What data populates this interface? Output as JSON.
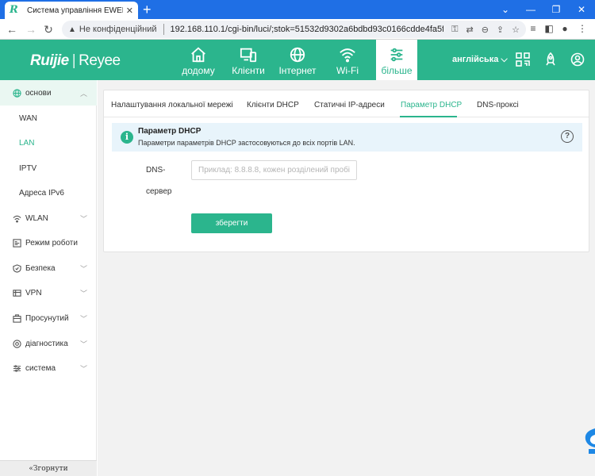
{
  "browser": {
    "tab_title": "Система управління EWEB",
    "tab_icon_letter": "R",
    "security_label": "Не конфіденційний",
    "url": "192.168.110.1/cgi-bin/luci/;stok=51532d9302a6bdbd93c0166cdde4fa5f/ad...",
    "new_tab": "+",
    "win_min": "⌄",
    "win_minimize": "—",
    "win_restore": "❐",
    "win_close": "✕",
    "tab_close": "✕"
  },
  "header": {
    "brand1": "Ruijie",
    "brand_sep": "|",
    "brand2": "Reyee",
    "nav": [
      {
        "label": "додому",
        "icon": "home-icon"
      },
      {
        "label": "Клієнти",
        "icon": "devices-icon"
      },
      {
        "label": "Інтернет",
        "icon": "globe-icon"
      },
      {
        "label": "Wi-Fi",
        "icon": "wifi-icon"
      },
      {
        "label": "більше",
        "icon": "settings-sliders-icon"
      }
    ],
    "language": "англійська ⌵",
    "accent_color": "#2bb58d"
  },
  "sidebar": {
    "items": [
      {
        "label": "основи",
        "icon": "globe-icon",
        "expanded": true
      },
      {
        "label": "WAN"
      },
      {
        "label": "LAN",
        "active": true
      },
      {
        "label": "IPTV"
      },
      {
        "label": "Адреса IPv6"
      },
      {
        "label": "WLAN",
        "icon": "wifi-icon"
      },
      {
        "label": "Режим роботи",
        "icon": "mode-icon"
      },
      {
        "label": "Безпека",
        "icon": "shield-icon"
      },
      {
        "label": "VPN",
        "icon": "vpn-icon"
      },
      {
        "label": "Просунутий",
        "icon": "briefcase-icon"
      },
      {
        "label": "діагностика",
        "icon": "diagnostics-icon"
      },
      {
        "label": "система",
        "icon": "system-icon"
      }
    ],
    "collapse_label": "«Згорнути"
  },
  "content": {
    "tabs": [
      "Налаштування локальної мережі",
      "Клієнти DHCP",
      "Статичні IP-адреси",
      "Параметр DHCP",
      "DNS-проксі"
    ],
    "active_tab": "Параметр DHCP",
    "info_title": "Параметр DHCP",
    "info_text": "Параметри параметрів DHCP застосовуються до всіх портів LAN.",
    "info_icon": "i",
    "help_icon": "?",
    "dns_label_1": "DNS-",
    "dns_label_2": "сервер",
    "dns_value": "",
    "dns_placeholder": "Приклад: 8.8.8.8, кожен розділений пробіл",
    "save_label": "зберегти"
  }
}
